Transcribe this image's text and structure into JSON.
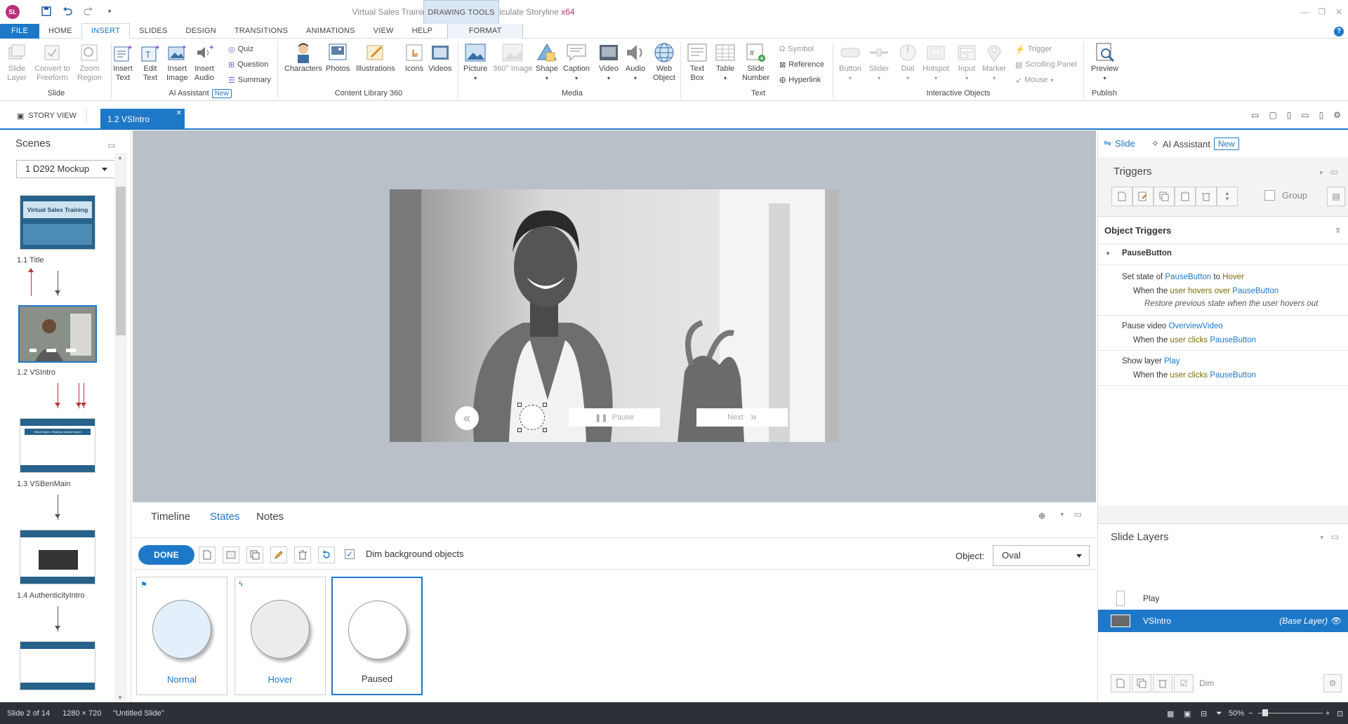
{
  "app": {
    "doc_name": "Virtual Sales Training - 2026.story*",
    "app_name": "Articulate Storyline",
    "arch": "x64",
    "logo": "SL",
    "context_tab_group": "DRAWING TOOLS"
  },
  "tabs": [
    "FILE",
    "HOME",
    "INSERT",
    "SLIDES",
    "DESIGN",
    "TRANSITIONS",
    "ANIMATIONS",
    "VIEW",
    "HELP",
    "FORMAT"
  ],
  "ribbon": {
    "slide": {
      "slide_layer": "Slide\nLayer",
      "convert": "Convert to\nFreeform",
      "zoom": "Zoom\nRegion",
      "group": "Slide"
    },
    "ai": {
      "insert_text": "Insert\nText",
      "edit_text": "Edit\nText",
      "insert_image": "Insert\nImage",
      "insert_audio": "Insert\nAudio",
      "quiz": "Quiz",
      "question": "Question",
      "summary": "Summary",
      "group": "AI Assistant",
      "badge": "New"
    },
    "content": {
      "characters": "Characters",
      "photos": "Photos",
      "illustrations": "Illustrations",
      "icons": "Icons",
      "videos": "Videos",
      "group": "Content Library 360"
    },
    "media": {
      "picture": "Picture",
      "image360": "360° Image",
      "shape": "Shape",
      "caption": "Caption",
      "video": "Video",
      "audio": "Audio",
      "web": "Web\nObject",
      "group": "Media"
    },
    "text": {
      "textbox": "Text\nBox",
      "table": "Table",
      "slidenum": "Slide\nNumber",
      "symbol": "Symbol",
      "reference": "Reference",
      "hyperlink": "Hyperlink",
      "group": "Text"
    },
    "interactive": {
      "button": "Button",
      "slider": "Slider",
      "dial": "Dial",
      "hotspot": "Hotspot",
      "input": "Input",
      "marker": "Marker",
      "trigger": "Trigger",
      "scrolling": "Scrolling Panel",
      "mouse": "Mouse",
      "group": "Interactive Objects"
    },
    "publish": {
      "preview": "Preview",
      "group": "Publish"
    }
  },
  "docbar": {
    "story_view": "STORY VIEW",
    "active_tab": "1.2 VSIntro"
  },
  "scenes": {
    "header": "Scenes",
    "selected_scene": "1 D292 Mockup",
    "thumbs": [
      {
        "label": "1.1 Title",
        "thumb_text": "Virtual Sales Training"
      },
      {
        "label": "1.2 VSIntro"
      },
      {
        "label": "1.3 VSBenMain",
        "thumb_text": "Virtual Sales: What you should expect"
      },
      {
        "label": "1.4 AuthenticityIntro"
      },
      {
        "label": ""
      }
    ]
  },
  "slide": {
    "pause_label": "Pause",
    "next_label": "Next"
  },
  "states_panel": {
    "tabs": [
      "Timeline",
      "States",
      "Notes"
    ],
    "done_label": "DONE",
    "dim_label": "Dim background objects",
    "dim_checked": true,
    "object_label": "Object:",
    "object_value": "Oval",
    "states": [
      {
        "name": "Normal",
        "fill": "#e3f0fb"
      },
      {
        "name": "Hover",
        "fill": "#ececec"
      },
      {
        "name": "Paused",
        "fill": "#ffffff"
      }
    ]
  },
  "right": {
    "tab_slide": "Slide",
    "tab_ai": "AI Assistant",
    "ai_badge": "New",
    "triggers_header": "Triggers",
    "group_label": "Group",
    "object_triggers": "Object Triggers",
    "trigger_object": "PauseButton",
    "triggers": [
      {
        "a1": "Set state of ",
        "a2": "PauseButton",
        "a3": " to ",
        "a4": "Hover",
        "b1": "When the ",
        "b2": "user hovers over",
        "b3": " ",
        "b4": "PauseButton",
        "c": "Restore previous state when the user hovers out"
      },
      {
        "a1": "Pause video ",
        "a2": "OverviewVideo",
        "b1": "When the ",
        "b2": "user clicks",
        "b3": " ",
        "b4": "PauseButton"
      },
      {
        "a1": "Show layer ",
        "a2": "Play",
        "b1": "When the ",
        "b2": "user clicks",
        "b3": " ",
        "b4": "PauseButton"
      }
    ],
    "layers_header": "Slide Layers",
    "layers": [
      {
        "name": "Play"
      },
      {
        "name": "VSIntro",
        "tag": "(Base Layer)"
      }
    ],
    "dim_label": "Dim"
  },
  "status": {
    "slide": "Slide 2 of 14",
    "size": "1280 × 720",
    "name": "\"Untitled Slide\"",
    "zoom": "50%"
  },
  "colors": {
    "accent": "#1e78c8",
    "logo": "#b8327a",
    "statusbar": "#2b3137"
  }
}
